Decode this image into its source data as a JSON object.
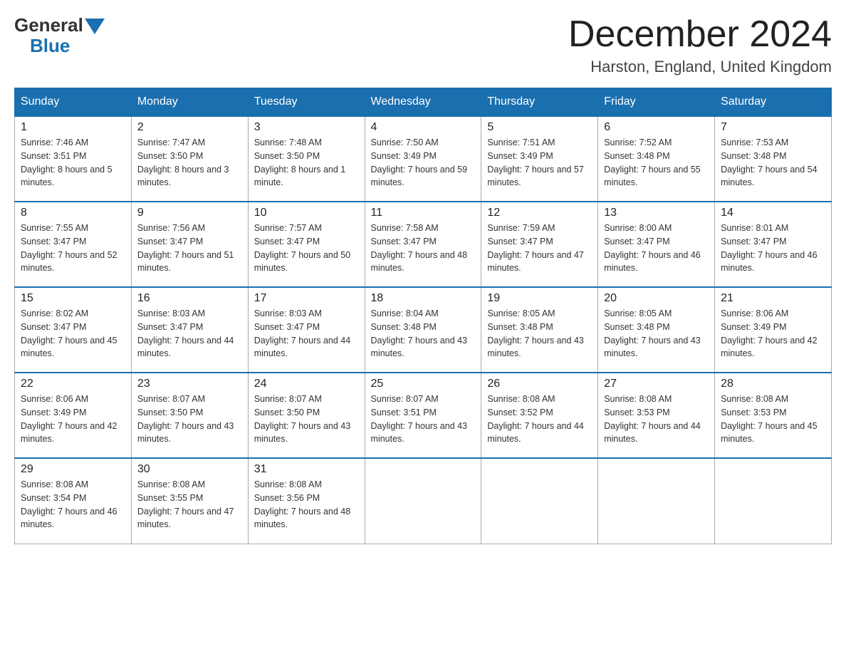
{
  "logo": {
    "general": "General",
    "blue": "Blue"
  },
  "title": "December 2024",
  "location": "Harston, England, United Kingdom",
  "days_of_week": [
    "Sunday",
    "Monday",
    "Tuesday",
    "Wednesday",
    "Thursday",
    "Friday",
    "Saturday"
  ],
  "weeks": [
    [
      {
        "day": "1",
        "sunrise": "7:46 AM",
        "sunset": "3:51 PM",
        "daylight": "8 hours and 5 minutes."
      },
      {
        "day": "2",
        "sunrise": "7:47 AM",
        "sunset": "3:50 PM",
        "daylight": "8 hours and 3 minutes."
      },
      {
        "day": "3",
        "sunrise": "7:48 AM",
        "sunset": "3:50 PM",
        "daylight": "8 hours and 1 minute."
      },
      {
        "day": "4",
        "sunrise": "7:50 AM",
        "sunset": "3:49 PM",
        "daylight": "7 hours and 59 minutes."
      },
      {
        "day": "5",
        "sunrise": "7:51 AM",
        "sunset": "3:49 PM",
        "daylight": "7 hours and 57 minutes."
      },
      {
        "day": "6",
        "sunrise": "7:52 AM",
        "sunset": "3:48 PM",
        "daylight": "7 hours and 55 minutes."
      },
      {
        "day": "7",
        "sunrise": "7:53 AM",
        "sunset": "3:48 PM",
        "daylight": "7 hours and 54 minutes."
      }
    ],
    [
      {
        "day": "8",
        "sunrise": "7:55 AM",
        "sunset": "3:47 PM",
        "daylight": "7 hours and 52 minutes."
      },
      {
        "day": "9",
        "sunrise": "7:56 AM",
        "sunset": "3:47 PM",
        "daylight": "7 hours and 51 minutes."
      },
      {
        "day": "10",
        "sunrise": "7:57 AM",
        "sunset": "3:47 PM",
        "daylight": "7 hours and 50 minutes."
      },
      {
        "day": "11",
        "sunrise": "7:58 AM",
        "sunset": "3:47 PM",
        "daylight": "7 hours and 48 minutes."
      },
      {
        "day": "12",
        "sunrise": "7:59 AM",
        "sunset": "3:47 PM",
        "daylight": "7 hours and 47 minutes."
      },
      {
        "day": "13",
        "sunrise": "8:00 AM",
        "sunset": "3:47 PM",
        "daylight": "7 hours and 46 minutes."
      },
      {
        "day": "14",
        "sunrise": "8:01 AM",
        "sunset": "3:47 PM",
        "daylight": "7 hours and 46 minutes."
      }
    ],
    [
      {
        "day": "15",
        "sunrise": "8:02 AM",
        "sunset": "3:47 PM",
        "daylight": "7 hours and 45 minutes."
      },
      {
        "day": "16",
        "sunrise": "8:03 AM",
        "sunset": "3:47 PM",
        "daylight": "7 hours and 44 minutes."
      },
      {
        "day": "17",
        "sunrise": "8:03 AM",
        "sunset": "3:47 PM",
        "daylight": "7 hours and 44 minutes."
      },
      {
        "day": "18",
        "sunrise": "8:04 AM",
        "sunset": "3:48 PM",
        "daylight": "7 hours and 43 minutes."
      },
      {
        "day": "19",
        "sunrise": "8:05 AM",
        "sunset": "3:48 PM",
        "daylight": "7 hours and 43 minutes."
      },
      {
        "day": "20",
        "sunrise": "8:05 AM",
        "sunset": "3:48 PM",
        "daylight": "7 hours and 43 minutes."
      },
      {
        "day": "21",
        "sunrise": "8:06 AM",
        "sunset": "3:49 PM",
        "daylight": "7 hours and 42 minutes."
      }
    ],
    [
      {
        "day": "22",
        "sunrise": "8:06 AM",
        "sunset": "3:49 PM",
        "daylight": "7 hours and 42 minutes."
      },
      {
        "day": "23",
        "sunrise": "8:07 AM",
        "sunset": "3:50 PM",
        "daylight": "7 hours and 43 minutes."
      },
      {
        "day": "24",
        "sunrise": "8:07 AM",
        "sunset": "3:50 PM",
        "daylight": "7 hours and 43 minutes."
      },
      {
        "day": "25",
        "sunrise": "8:07 AM",
        "sunset": "3:51 PM",
        "daylight": "7 hours and 43 minutes."
      },
      {
        "day": "26",
        "sunrise": "8:08 AM",
        "sunset": "3:52 PM",
        "daylight": "7 hours and 44 minutes."
      },
      {
        "day": "27",
        "sunrise": "8:08 AM",
        "sunset": "3:53 PM",
        "daylight": "7 hours and 44 minutes."
      },
      {
        "day": "28",
        "sunrise": "8:08 AM",
        "sunset": "3:53 PM",
        "daylight": "7 hours and 45 minutes."
      }
    ],
    [
      {
        "day": "29",
        "sunrise": "8:08 AM",
        "sunset": "3:54 PM",
        "daylight": "7 hours and 46 minutes."
      },
      {
        "day": "30",
        "sunrise": "8:08 AM",
        "sunset": "3:55 PM",
        "daylight": "7 hours and 47 minutes."
      },
      {
        "day": "31",
        "sunrise": "8:08 AM",
        "sunset": "3:56 PM",
        "daylight": "7 hours and 48 minutes."
      },
      null,
      null,
      null,
      null
    ]
  ]
}
